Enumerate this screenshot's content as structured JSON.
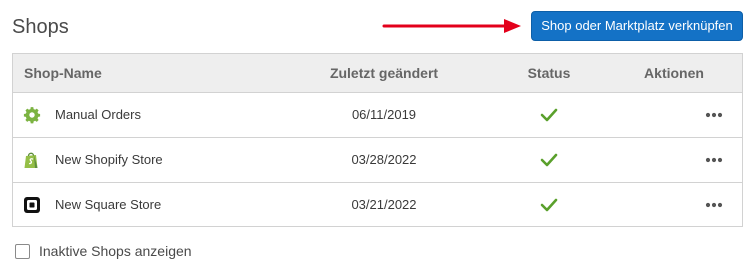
{
  "page": {
    "title": "Shops"
  },
  "toolbar": {
    "connect_label": "Shop oder Marktplatz verknüpfen"
  },
  "colors": {
    "accent": "#1472c6",
    "annotation_arrow": "#e3001b",
    "status_ok": "#5aa02c"
  },
  "table": {
    "headers": {
      "name": "Shop-Name",
      "changed": "Zuletzt geändert",
      "status": "Status",
      "actions": "Aktionen"
    },
    "rows": [
      {
        "icon": "gear-icon",
        "name": "Manual Orders",
        "changed": "06/11/2019",
        "status": "active",
        "status_icon": "checkmark-icon",
        "actions_icon": "more-horizontal-icon"
      },
      {
        "icon": "shopify-bag-icon",
        "name": "New Shopify Store",
        "changed": "03/28/2022",
        "status": "active",
        "status_icon": "checkmark-icon",
        "actions_icon": "more-horizontal-icon"
      },
      {
        "icon": "square-logo-icon",
        "name": "New Square Store",
        "changed": "03/21/2022",
        "status": "active",
        "status_icon": "checkmark-icon",
        "actions_icon": "more-horizontal-icon"
      }
    ]
  },
  "footer": {
    "show_inactive_label": "Inaktive Shops anzeigen",
    "show_inactive_checked": false
  }
}
